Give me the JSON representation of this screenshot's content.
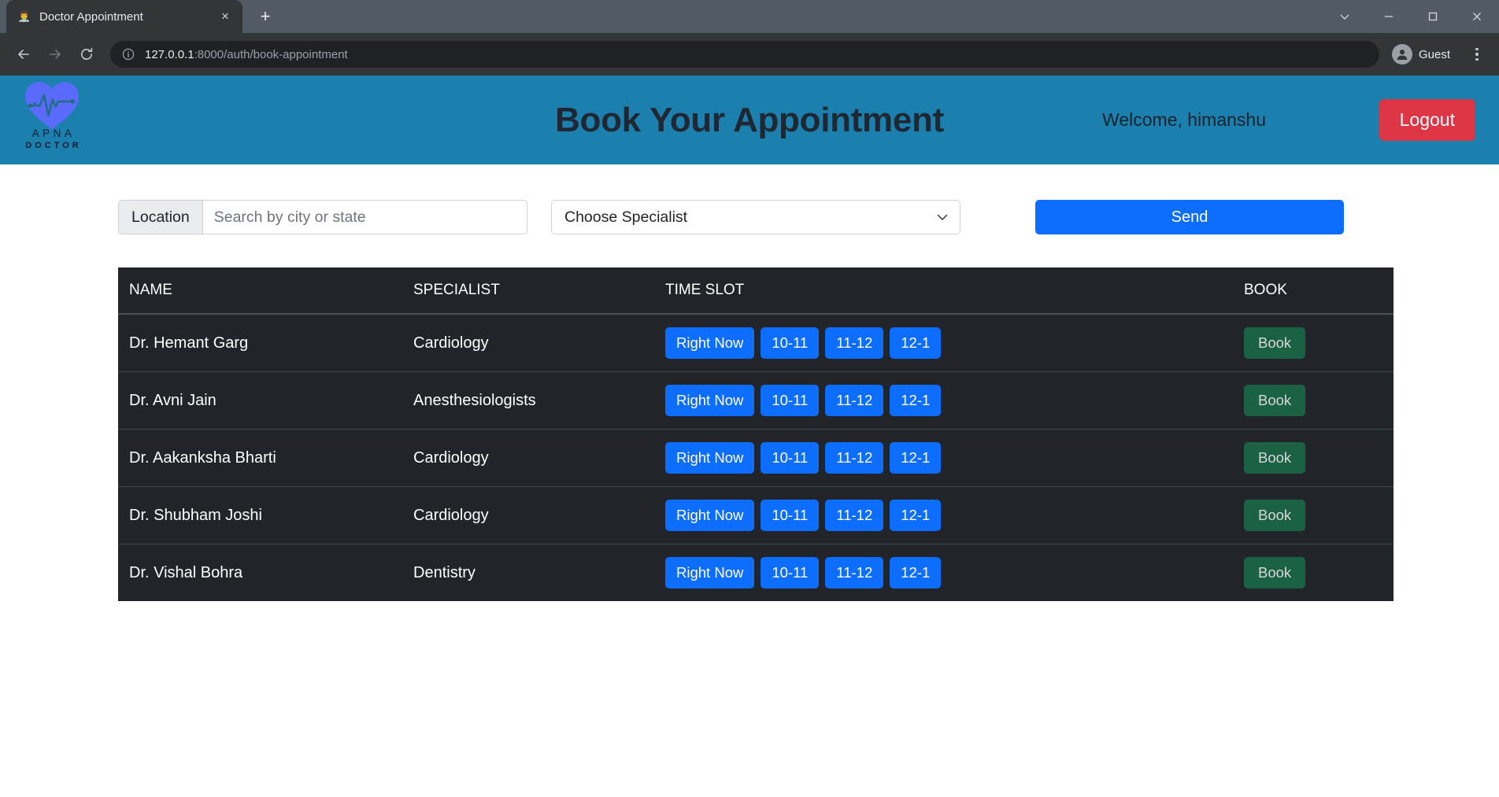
{
  "browser": {
    "tab": {
      "title": "Doctor Appointment",
      "favicon": "doctor-favicon",
      "close_label": "×"
    },
    "new_tab_label": "+",
    "window_controls": {
      "expand": "chevron-down-icon",
      "minimize": "minimize-icon",
      "maximize": "maximize-icon",
      "close": "close-icon"
    },
    "nav": {
      "back": "←",
      "forward": "→",
      "reload": "↻"
    },
    "omnibox": {
      "info_icon": "info-circle-icon",
      "url_host": "127.0.0.1",
      "url_path": ":8000/auth/book-appointment"
    },
    "profile": {
      "name": "Guest",
      "avatar": "person-avatar-icon"
    },
    "menu_icon": "kebab-menu-icon"
  },
  "header": {
    "logo": {
      "mark": "heart-ecg-logo-icon",
      "line1": "APNA",
      "line2": "DOCTOR",
      "heart_color": "#5a6bfb",
      "ecg_color": "#1d6f7d"
    },
    "title": "Book Your Appointment",
    "welcome": "Welcome, himanshu",
    "logout_label": "Logout",
    "bg_color": "#1b80ad",
    "logout_color": "#dc3545"
  },
  "filters": {
    "location_label": "Location",
    "location_placeholder": "Search by city or state",
    "location_value": "",
    "specialist_selected": "Choose Specialist",
    "specialist_options": [
      "Choose Specialist"
    ],
    "caret_icon": "chevron-down-icon",
    "send_label": "Send",
    "send_color": "#0d6efd"
  },
  "table": {
    "columns": [
      "NAME",
      "SPECIALIST",
      "TIME SLOT",
      "BOOK"
    ],
    "slot_labels": [
      "Right Now",
      "10-11",
      "11-12",
      "12-1"
    ],
    "book_label": "Book",
    "slot_color": "#0d6efd",
    "book_color": "#1b6245",
    "rows": [
      {
        "name": "Dr. Hemant Garg",
        "specialist": "Cardiology"
      },
      {
        "name": "Dr. Avni Jain",
        "specialist": "Anesthesiologists"
      },
      {
        "name": "Dr. Aakanksha Bharti",
        "specialist": "Cardiology"
      },
      {
        "name": "Dr. Shubham Joshi",
        "specialist": "Cardiology"
      },
      {
        "name": "Dr. Vishal Bohra",
        "specialist": "Dentistry"
      }
    ]
  }
}
